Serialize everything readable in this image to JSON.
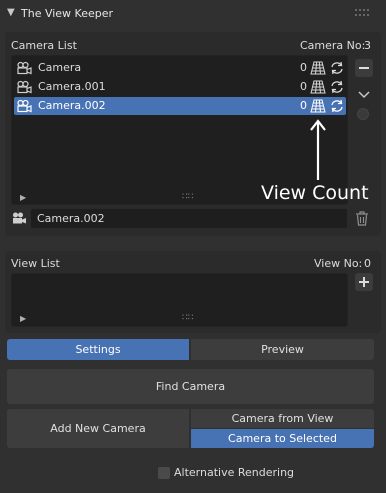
{
  "panel": {
    "title": "The View Keeper"
  },
  "camera_list": {
    "label": "Camera List",
    "count_label": "Camera No:",
    "count_value": "3",
    "items": [
      {
        "name": "Camera",
        "view_count": "0",
        "selected": false
      },
      {
        "name": "Camera.001",
        "view_count": "0",
        "selected": false
      },
      {
        "name": "Camera.002",
        "view_count": "0",
        "selected": true
      }
    ],
    "selected_name": "Camera.002"
  },
  "annotation": {
    "text": "View Count"
  },
  "view_list": {
    "label": "View List",
    "count_label": "View No:",
    "count_value": "0"
  },
  "tabs": {
    "settings": "Settings",
    "preview": "Preview",
    "active": "settings"
  },
  "buttons": {
    "find_camera": "Find Camera",
    "add_new_camera": "Add New Camera",
    "camera_from_view": "Camera from View",
    "camera_to_selected": "Camera to Selected"
  },
  "options": {
    "alternative_rendering": "Alternative Rendering",
    "alternative_rendering_checked": false
  },
  "colors": {
    "accent": "#4772b3",
    "background": "#303030",
    "list_bg": "#1f1f1f"
  }
}
